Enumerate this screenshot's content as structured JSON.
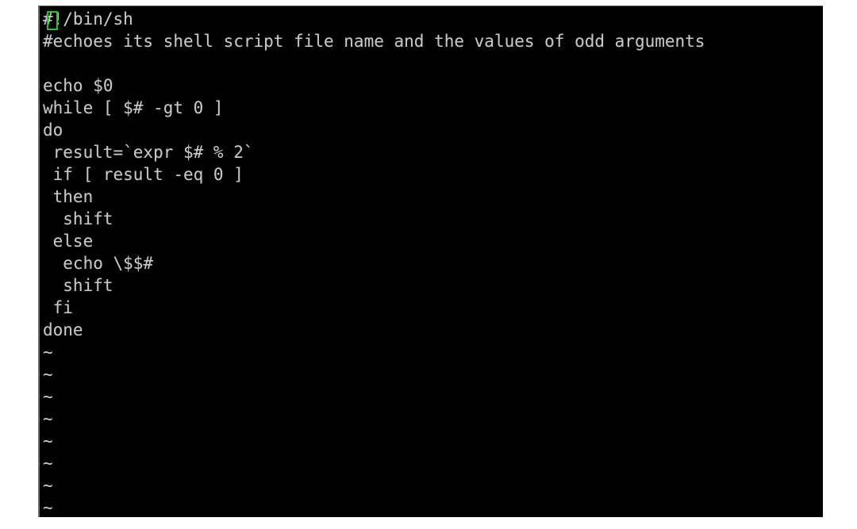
{
  "window": {
    "kind": "terminal",
    "editor": "vim",
    "background_color": "#000000",
    "foreground_color": "#c8c8c8",
    "page_background_color": "#ffffff",
    "border_color": "#6e6e6e"
  },
  "cursor": {
    "type": "block-outline",
    "color": "#23c423",
    "line": 1,
    "column": 1,
    "char": "#"
  },
  "buffer": {
    "lines": [
      "#!/bin/sh",
      "#echoes its shell script file name and the values of odd arguments",
      "",
      "echo $0",
      "while [ $# -gt 0 ]",
      "do",
      " result=`expr $# % 2`",
      " if [ result -eq 0 ]",
      " then",
      "  shift",
      " else",
      "  echo \\$$#",
      "  shift",
      " fi",
      "done"
    ],
    "empty_line_markers": [
      "~",
      "~",
      "~",
      "~",
      "~",
      "~",
      "~",
      "~"
    ]
  }
}
